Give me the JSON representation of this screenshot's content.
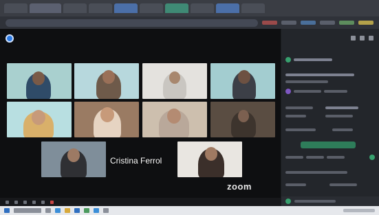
{
  "meeting": {
    "participant_name": "Cristina Ferrol",
    "watermark": "zoom",
    "colors": {
      "stage_bg": "#0e0f11",
      "panel_bg": "#23262b",
      "accent_blue": "#2c7be5",
      "accent_green": "#37a06e",
      "leave_red": "#c84545"
    }
  },
  "icons": {
    "security": "shield-icon",
    "mic": "microphone-icon",
    "camera": "camera-icon",
    "leave": "leave-icon"
  }
}
